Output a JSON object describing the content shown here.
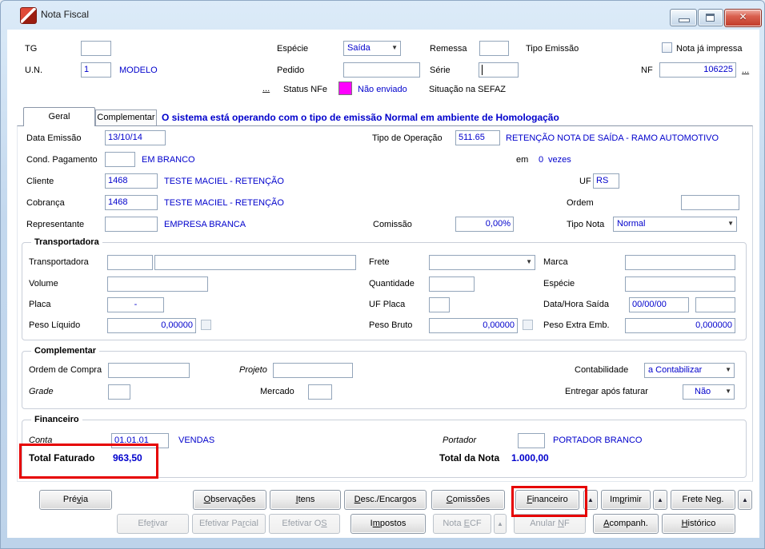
{
  "window": {
    "title": "Nota Fiscal"
  },
  "icons": {
    "dropdown_arrow": "▼"
  },
  "annotation_color": "#e60000",
  "header": {
    "tg": {
      "label": "TG",
      "value": ""
    },
    "un": {
      "label": "U.N.",
      "value": "1",
      "desc": "MODELO"
    },
    "especie": {
      "label": "Espécie",
      "value": "Saída"
    },
    "pedido": {
      "label": "Pedido",
      "value": ""
    },
    "remessa": {
      "label": "Remessa",
      "value": ""
    },
    "serie": {
      "label": "Série",
      "value": ""
    },
    "tipo_emissao": {
      "label": "Tipo Emissão"
    },
    "nota_ja_impressa": {
      "label": "Nota já impressa",
      "checked": false
    },
    "nf": {
      "label": "NF",
      "value": "106225",
      "more": "..."
    },
    "status_nfe": {
      "more": "...",
      "label": "Status NFe",
      "value": "Não enviado",
      "color": "#ff00ff"
    },
    "situacao_sefaz": {
      "label": "Situação na SEFAZ"
    }
  },
  "tabs": {
    "geral": "Geral",
    "complementar": "Complementar"
  },
  "message": "O sistema está operando com o tipo de emissão Normal em ambiente de Homologação",
  "geral": {
    "data_emissao": {
      "label": "Data Emissão",
      "value": "13/10/14"
    },
    "tipo_operacao": {
      "label": "Tipo de Operação",
      "value": "511.65",
      "desc": "RETENÇÃO NOTA DE SAÍDA - RAMO AUTOMOTIVO"
    },
    "cond_pagamento": {
      "label": "Cond. Pagamento",
      "value": "",
      "desc": "EM BRANCO"
    },
    "parcelas": {
      "em_label": "em",
      "value": "0",
      "vezes_label": "vezes"
    },
    "cliente": {
      "label": "Cliente",
      "value": "1468",
      "desc": "TESTE MACIEL - RETENÇÃO"
    },
    "uf": {
      "label": "UF",
      "value": "RS"
    },
    "cobranca": {
      "label": "Cobrança",
      "value": "1468",
      "desc": "TESTE MACIEL - RETENÇÃO"
    },
    "ordem": {
      "label": "Ordem",
      "value": ""
    },
    "representante": {
      "label": "Representante",
      "value": "",
      "desc": "EMPRESA BRANCA"
    },
    "comissao": {
      "label": "Comissão",
      "value": "0,00%"
    },
    "tipo_nota": {
      "label": "Tipo Nota",
      "value": "Normal"
    }
  },
  "transportadora": {
    "legend": "Transportadora",
    "transportadora": {
      "label": "Transportadora",
      "code": "",
      "name": ""
    },
    "frete": {
      "label": "Frete",
      "value": ""
    },
    "marca": {
      "label": "Marca",
      "value": ""
    },
    "volume": {
      "label": "Volume",
      "value": ""
    },
    "quantidade": {
      "label": "Quantidade",
      "value": ""
    },
    "especie": {
      "label": "Espécie",
      "value": ""
    },
    "placa": {
      "label": "Placa",
      "value": "-"
    },
    "uf_placa": {
      "label": "UF Placa",
      "value": ""
    },
    "data_hora_saida": {
      "label": "Data/Hora Saída",
      "date": "00/00/00",
      "time": ""
    },
    "peso_liquido": {
      "label": "Peso Líquido",
      "value": "0,00000"
    },
    "peso_bruto": {
      "label": "Peso Bruto",
      "value": "0,00000"
    },
    "peso_extra": {
      "label": "Peso Extra Emb.",
      "value": "0,000000"
    }
  },
  "complementar": {
    "legend": "Complementar",
    "ordem_compra": {
      "label": "Ordem de Compra",
      "value": ""
    },
    "projeto": {
      "label": "Projeto",
      "value": ""
    },
    "contabilidade": {
      "label": "Contabilidade",
      "value": "a Contabilizar"
    },
    "grade": {
      "label": "Grade",
      "value": ""
    },
    "mercado": {
      "label": "Mercado",
      "value": ""
    },
    "entregar_apos_faturar": {
      "label": "Entregar após faturar",
      "value": "Não"
    }
  },
  "financeiro": {
    "legend": "Financeiro",
    "conta": {
      "label": "Conta",
      "value": "01.01.01",
      "desc": "VENDAS"
    },
    "portador": {
      "label": "Portador",
      "value": "",
      "desc": "PORTADOR BRANCO"
    },
    "total_faturado": {
      "label": "Total Faturado",
      "value": "963,50"
    },
    "total_nota": {
      "label": "Total da Nota",
      "value": "1.000,00"
    }
  },
  "buttons": {
    "row1": [
      {
        "label": "Prévia",
        "ul": 3,
        "enabled": true
      },
      {
        "label": "Observações",
        "ul": 0,
        "enabled": true
      },
      {
        "label": "Itens",
        "ul": 0,
        "enabled": true
      },
      {
        "label": "Desc./Encargos",
        "ul": 0,
        "enabled": true
      },
      {
        "label": "Comissões",
        "ul": 0,
        "enabled": true
      },
      {
        "label": "Financeiro",
        "ul": 0,
        "enabled": true,
        "highlighted": true
      },
      {
        "label": "▲",
        "enabled": true
      },
      {
        "label": "Imprimir",
        "ul": 2,
        "enabled": true
      },
      {
        "label": "▲",
        "enabled": true
      },
      {
        "label": "Frete Neg.",
        "ul": 8,
        "enabled": true
      },
      {
        "label": "▲",
        "enabled": true
      }
    ],
    "row2": [
      {
        "label": "Efetivar",
        "ul": 3,
        "enabled": false
      },
      {
        "label": "Efetivar Parcial",
        "ul": 11,
        "enabled": false
      },
      {
        "label": "Efetivar OS",
        "ul": 10,
        "enabled": false
      },
      {
        "label": "Impostos",
        "ul": 1,
        "enabled": true
      },
      {
        "label": "Nota ECF",
        "ul": 5,
        "enabled": false
      },
      {
        "label": "▲",
        "enabled": false
      },
      {
        "label": "Anular NF",
        "ul": 7,
        "enabled": false
      },
      {
        "label": "Acompanh.",
        "ul": 0,
        "enabled": true
      },
      {
        "label": "Histórico",
        "ul": 0,
        "enabled": true
      }
    ]
  }
}
